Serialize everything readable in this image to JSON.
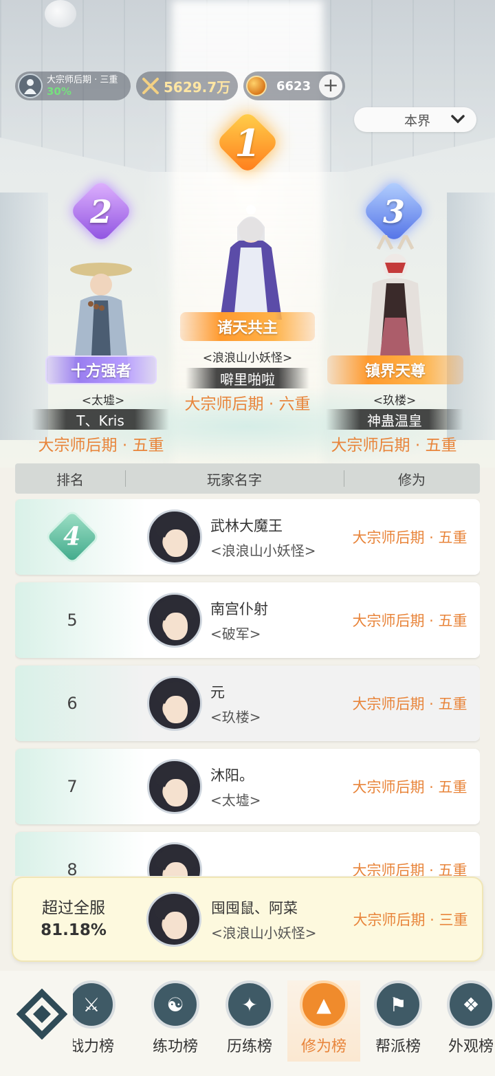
{
  "status": {
    "realm_name": "大宗师后期 · 三重",
    "realm_pct": "30%",
    "power": "5629.7万",
    "coins": "6623",
    "plus": "+"
  },
  "scope": {
    "label": "本界",
    "icon": "chevron-down-icon"
  },
  "podium": {
    "first": {
      "rank": "1",
      "title": "诸天共主",
      "guild": "<浪浪山小妖怪>",
      "name": "噼里啪啦",
      "realm": "大宗师后期 · 六重"
    },
    "second": {
      "rank": "2",
      "title": "十方强者",
      "guild": "<太墟>",
      "name": "T、Kris",
      "realm": "大宗师后期 · 五重"
    },
    "third": {
      "rank": "3",
      "title": "镇界天尊",
      "guild": "<玖楼>",
      "name": "神蛊温皇",
      "realm": "大宗师后期 · 五重"
    }
  },
  "table": {
    "headers": {
      "rank": "排名",
      "name": "玩家名字",
      "realm": "修为"
    },
    "rows": [
      {
        "rank": "4",
        "name": "武林大魔王",
        "guild": "<浪浪山小妖怪>",
        "realm": "大宗师后期 · 五重"
      },
      {
        "rank": "5",
        "name": "南宫仆射",
        "guild": "<破军>",
        "realm": "大宗师后期 · 五重"
      },
      {
        "rank": "6",
        "name": "元",
        "guild": "<玖楼>",
        "realm": "大宗师后期 · 五重"
      },
      {
        "rank": "7",
        "name": "沐阳。",
        "guild": "<太墟>",
        "realm": "大宗师后期 · 五重"
      },
      {
        "rank": "8",
        "name": "",
        "guild": "",
        "realm": "大宗师后期 · 五重"
      }
    ]
  },
  "me": {
    "exceed_label": "超过全服",
    "exceed_value": "81.18%",
    "name": "囤囤鼠、阿菜",
    "guild": "<浪浪山小妖怪>",
    "realm": "大宗师后期 · 三重"
  },
  "nav": {
    "items": [
      {
        "label": "战力榜",
        "icon": "crossed-swords-icon",
        "active": false
      },
      {
        "label": "练功榜",
        "icon": "yin-yang-icon",
        "active": false
      },
      {
        "label": "历练榜",
        "icon": "shuriken-icon",
        "active": false
      },
      {
        "label": "修为榜",
        "icon": "hat-icon",
        "active": true
      },
      {
        "label": "帮派榜",
        "icon": "banner-icon",
        "active": false
      },
      {
        "label": "外观榜",
        "icon": "emblem-icon",
        "active": false
      }
    ]
  },
  "colors": {
    "accent": "#e8843a",
    "row_tint": "#d9f1e8",
    "panel": "#fdf9de"
  }
}
